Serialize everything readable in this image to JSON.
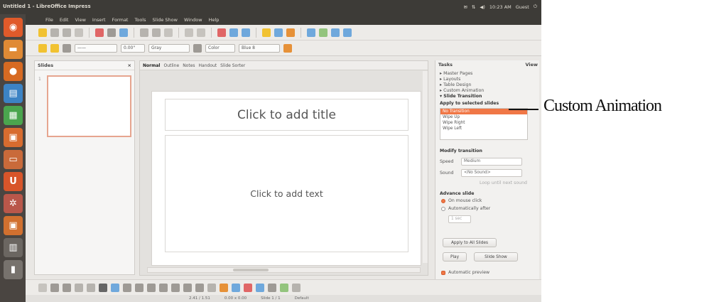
{
  "window": {
    "title": "Untitled 1 - LibreOffice Impress",
    "clock": "10:23 AM",
    "user": "Guest"
  },
  "menu": [
    "File",
    "Edit",
    "View",
    "Insert",
    "Format",
    "Tools",
    "Slide Show",
    "Window",
    "Help"
  ],
  "toolbar": {
    "font_size": "0.00\"",
    "line_style": "Gray",
    "area_color": "Color",
    "fill": "Blue 8"
  },
  "slides_pane": {
    "title": "Slides",
    "slide_number": "1"
  },
  "view_tabs": [
    "Normal",
    "Outline",
    "Notes",
    "Handout",
    "Slide Sorter"
  ],
  "slide": {
    "title_placeholder": "Click to add title",
    "text_placeholder": "Click to add text"
  },
  "tasks": {
    "title": "Tasks",
    "view_label": "View",
    "sections": [
      "Master Pages",
      "Layouts",
      "Table Design",
      "Custom Animation",
      "Slide Transition"
    ],
    "apply_label": "Apply to selected slides",
    "transitions": [
      "No Transition",
      "Wipe Up",
      "Wipe Right",
      "Wipe Left"
    ],
    "modify_label": "Modify transition",
    "speed_label": "Speed",
    "speed_value": "Medium",
    "sound_label": "Sound",
    "sound_value": "<No Sound>",
    "loop_label": "Loop until next sound",
    "advance_label": "Advance slide",
    "on_click": "On mouse click",
    "auto_after": "Automatically after",
    "time_value": "1 sec",
    "apply_all": "Apply to All Slides",
    "play": "Play",
    "slide_show": "Slide Show",
    "auto_preview": "Automatic preview"
  },
  "status": {
    "position": "2.41 / 1.51",
    "size": "0.00 x 0.00",
    "slide_info": "Slide 1 / 1",
    "layout": "Default"
  },
  "annotation": {
    "label": "Custom Animation"
  },
  "colors": {
    "accent": "#f07746",
    "launcher": "#4a4541",
    "topbar": "#3d3b37"
  },
  "launcher_icons": [
    "ubuntu-logo-icon",
    "files-icon",
    "firefox-icon",
    "writer-icon",
    "calc-icon",
    "impress-icon",
    "software-center-icon",
    "ubuntu-one-icon",
    "settings-icon",
    "impress-doc-icon",
    "workspace-icon",
    "usb-drive-icon"
  ]
}
